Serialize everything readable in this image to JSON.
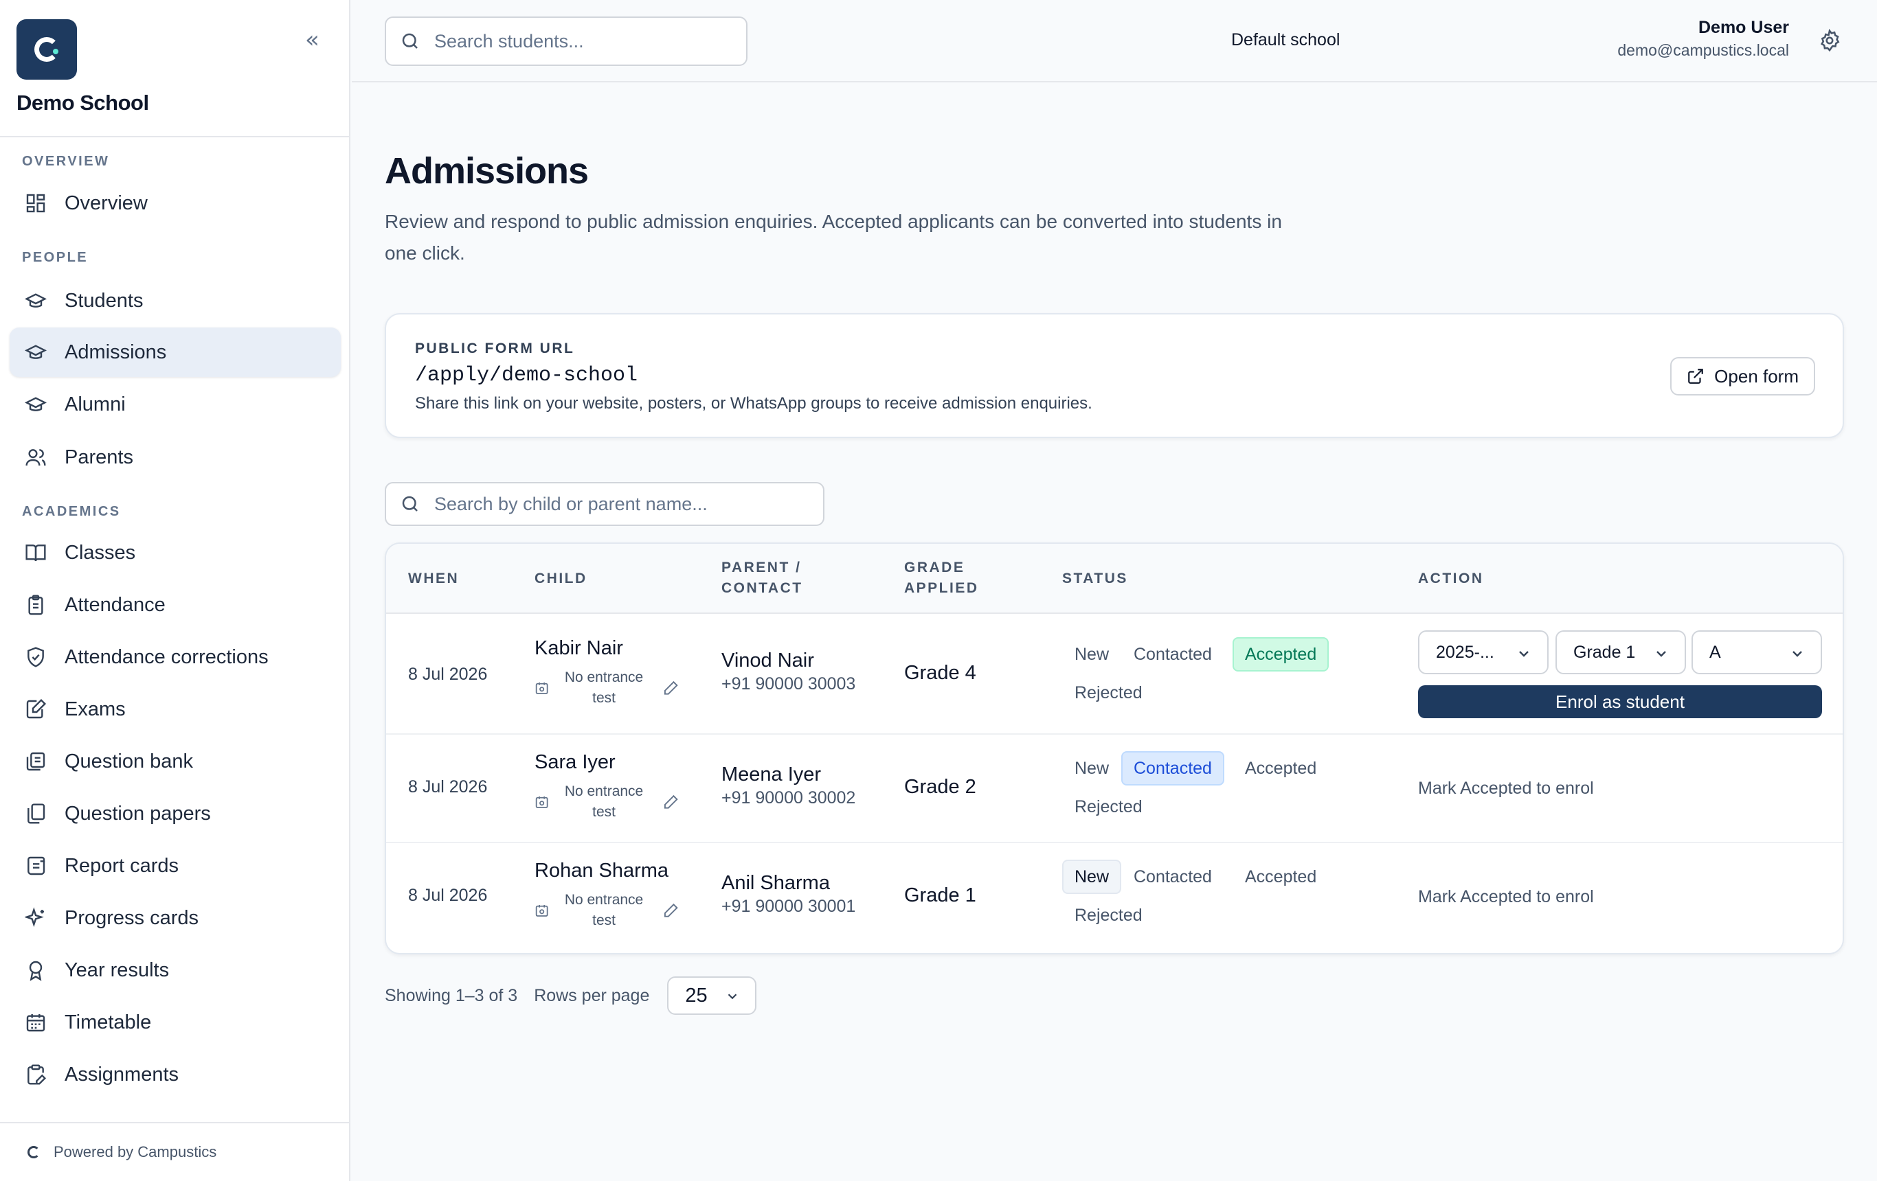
{
  "sidebar": {
    "school_name": "Demo School",
    "collapse_glyph": "«",
    "sections": {
      "overview": "OVERVIEW",
      "people": "PEOPLE",
      "academics": "ACADEMICS"
    },
    "items": {
      "overview": "Overview",
      "students": "Students",
      "admissions": "Admissions",
      "alumni": "Alumni",
      "parents": "Parents",
      "classes": "Classes",
      "attendance": "Attendance",
      "attendance_corrections": "Attendance corrections",
      "exams": "Exams",
      "question_bank": "Question bank",
      "question_papers": "Question papers",
      "report_cards": "Report cards",
      "progress_cards": "Progress cards",
      "year_results": "Year results",
      "timetable": "Timetable",
      "assignments": "Assignments"
    },
    "active": "admissions",
    "footer": "Powered by Campustics"
  },
  "topbar": {
    "search_placeholder": "Search students...",
    "school": "Default school",
    "user_name": "Demo User",
    "user_email": "demo@campustics.local"
  },
  "page": {
    "title": "Admissions",
    "description": "Review and respond to public admission enquiries. Accepted applicants can be converted into students in one click."
  },
  "form_card": {
    "label": "PUBLIC FORM URL",
    "url": "/apply/demo-school",
    "hint": "Share this link on your website, posters, or WhatsApp groups to receive admission enquiries.",
    "button": "Open form"
  },
  "table": {
    "search_placeholder": "Search by child or parent name...",
    "headers": {
      "when": "WHEN",
      "child": "CHILD",
      "parent_1": "PARENT /",
      "parent_2": "CONTACT",
      "grade_1": "GRADE",
      "grade_2": "APPLIED",
      "status": "STATUS",
      "action": "ACTION"
    },
    "status_labels": {
      "new": "New",
      "contacted": "Contacted",
      "accepted": "Accepted",
      "rejected": "Rejected"
    },
    "entrance_1": "No entrance",
    "entrance_2": "test",
    "rows": [
      {
        "when": "8 Jul 2026",
        "child": "Kabir Nair",
        "parent": "Vinod Nair",
        "phone": "+91 90000 30003",
        "grade": "Grade 4",
        "status": "accepted"
      },
      {
        "when": "8 Jul 2026",
        "child": "Sara Iyer",
        "parent": "Meena Iyer",
        "phone": "+91 90000 30002",
        "grade": "Grade 2",
        "status": "contacted",
        "action_hint": "Mark Accepted to enrol"
      },
      {
        "when": "8 Jul 2026",
        "child": "Rohan Sharma",
        "parent": "Anil Sharma",
        "phone": "+91 90000 30001",
        "grade": "Grade 1",
        "status": "new",
        "action_hint": "Mark Accepted to enrol"
      }
    ],
    "enrol": {
      "year": "2025-...",
      "grade": "Grade 1",
      "section": "A",
      "button": "Enrol as student"
    }
  },
  "pagination": {
    "showing": "Showing 1–3 of 3",
    "rows_label": "Rows per page",
    "rows_value": "25"
  },
  "colors": {
    "brand": "#1e3a5f",
    "accepted": "#047857",
    "contacted": "#1d4ed8"
  }
}
